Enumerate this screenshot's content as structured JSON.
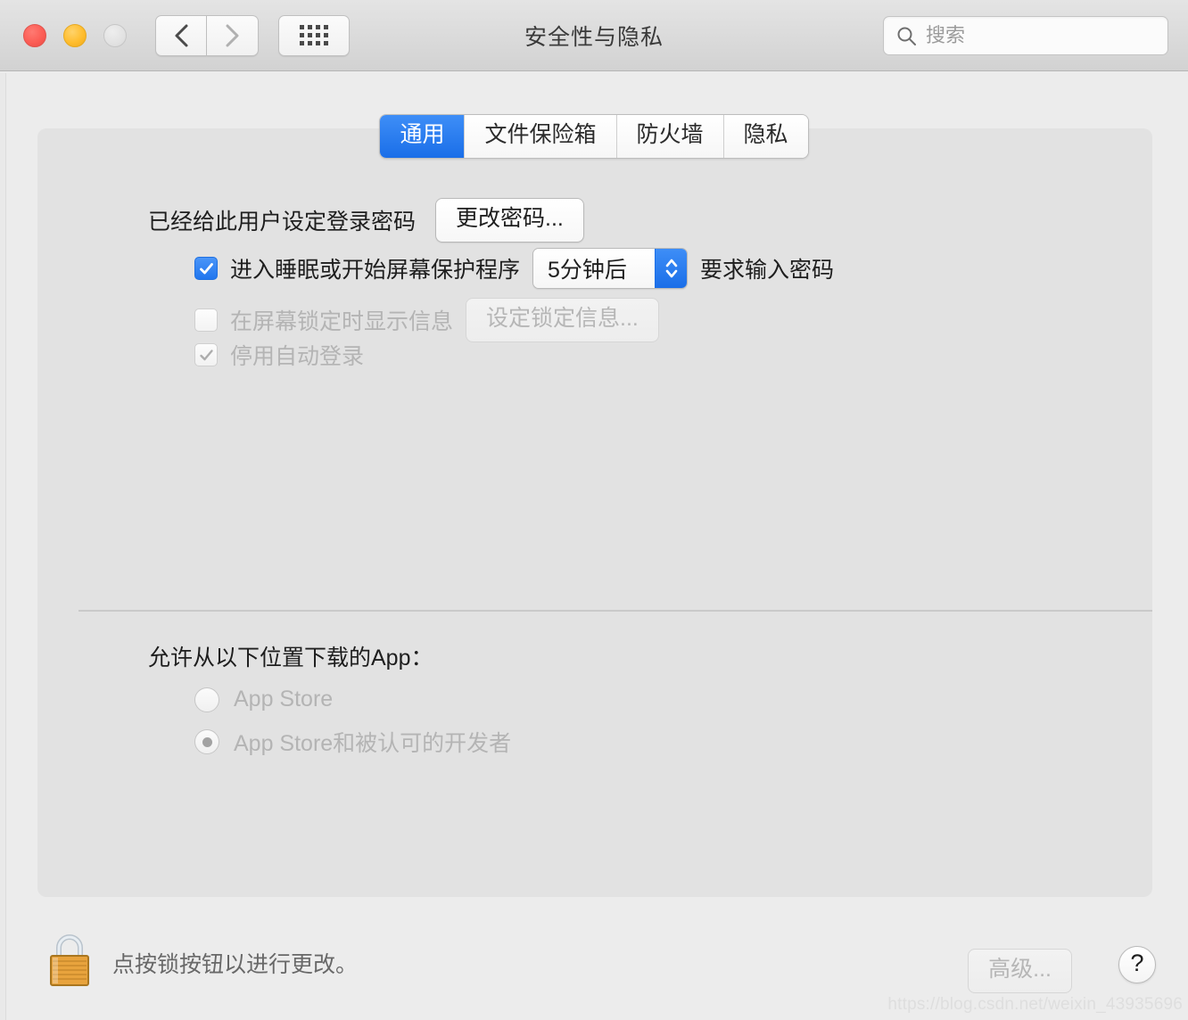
{
  "window": {
    "title": "安全性与隐私",
    "traffic_lights": [
      "close",
      "minimize",
      "zoom"
    ],
    "nav": {
      "back": "back-chevron",
      "forward": "forward-chevron",
      "grid": "show-all-grid"
    },
    "search": {
      "placeholder": "搜索",
      "value": "",
      "icon": "search-icon"
    }
  },
  "tabs": [
    {
      "label": "通用",
      "active": true
    },
    {
      "label": "文件保险箱",
      "active": false
    },
    {
      "label": "防火墙",
      "active": false
    },
    {
      "label": "隐私",
      "active": false
    }
  ],
  "general": {
    "password_status": "已经给此用户设定登录密码",
    "change_password_button": "更改密码...",
    "require_password": {
      "checked": true,
      "prefix_label": "进入睡眠或开始屏幕保护程序",
      "delay_value": "5分钟后",
      "suffix_label": "要求输入密码"
    },
    "show_message": {
      "checked": false,
      "disabled": true,
      "label": "在屏幕锁定时显示信息",
      "button": "设定锁定信息..."
    },
    "disable_auto_login": {
      "checked": true,
      "disabled": true,
      "label": "停用自动登录"
    },
    "download_section": {
      "heading": "允许从以下位置下载的App：",
      "options": [
        {
          "label": "App Store",
          "selected": false,
          "disabled": true
        },
        {
          "label": "App Store和被认可的开发者",
          "selected": true,
          "disabled": true
        }
      ]
    }
  },
  "footer": {
    "lock_icon": "lock-closed-icon",
    "lock_note": "点按锁按钮以进行更改。",
    "advanced_button": "高级...",
    "advanced_disabled": true,
    "help_button": "?"
  },
  "watermark": "https://blog.csdn.net/weixin_43935696",
  "colors": {
    "accent_blue": "#1a6ee8",
    "window_bg": "#ececec",
    "panel_bg": "#e2e2e2",
    "disabled_text": "#b4b4b4",
    "lock_gold": "#e8a33d"
  }
}
